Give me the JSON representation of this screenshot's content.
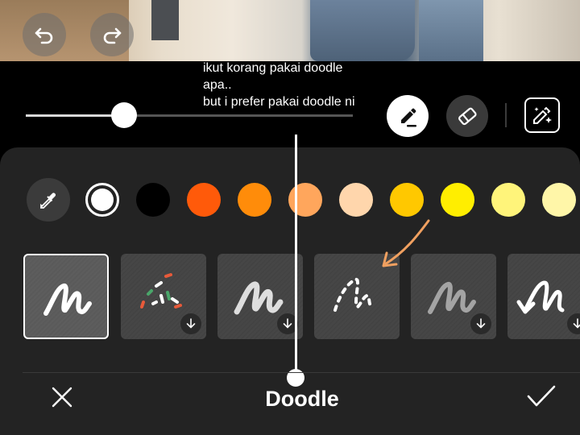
{
  "overlay_text": {
    "line1": "ikut korang pakai doodle",
    "line2": "apa..",
    "line3": "but i prefer pakai doodle ni"
  },
  "top_bar": {
    "undo_icon": "undo-icon",
    "redo_icon": "redo-icon"
  },
  "brush_size_slider": {
    "value_fraction": 0.3
  },
  "tools": [
    {
      "name": "pen",
      "icon": "pen-icon",
      "active": true
    },
    {
      "name": "eraser",
      "icon": "eraser-icon",
      "active": false
    },
    {
      "name": "ai-draw",
      "icon": "sparkle-pen-icon",
      "active": false
    }
  ],
  "colors": {
    "eyedropper_icon": "eyedropper-icon",
    "swatches": [
      "#ffffff",
      "#000000",
      "#ff5a0a",
      "#ff8c0a",
      "#ffa65c",
      "#ffd6ac",
      "#ffc800",
      "#ffee00",
      "#fff47a",
      "#fff6a8"
    ],
    "selected": "#ffffff"
  },
  "brushes": [
    {
      "name": "solid-brush",
      "selected": true,
      "download": false
    },
    {
      "name": "sprinkles-brush",
      "selected": false,
      "download": true
    },
    {
      "name": "chalk-brush",
      "selected": false,
      "download": true
    },
    {
      "name": "dashed-brush",
      "selected": false,
      "download": false
    },
    {
      "name": "pencil-brush",
      "selected": false,
      "download": true
    },
    {
      "name": "arrow-brush",
      "selected": false,
      "download": true
    }
  ],
  "footer": {
    "title": "Doodle",
    "cancel_icon": "close-icon",
    "confirm_icon": "check-icon"
  }
}
